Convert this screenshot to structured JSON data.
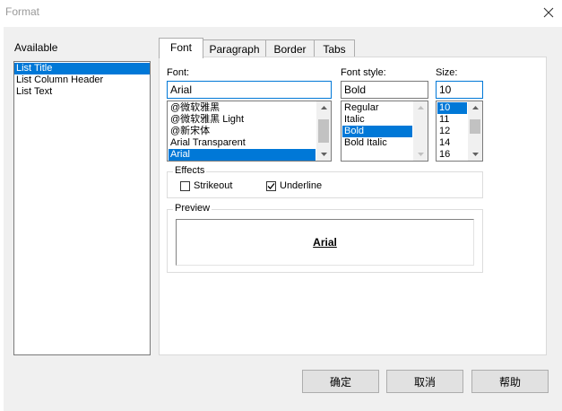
{
  "window": {
    "title": "Format"
  },
  "available": {
    "label": "Available",
    "items": [
      "List Title",
      "List Column Header",
      "List Text"
    ],
    "selected_index": 0
  },
  "tabs": [
    {
      "label": "Font",
      "active": true
    },
    {
      "label": "Paragraph",
      "active": false
    },
    {
      "label": "Border",
      "active": false
    },
    {
      "label": "Tabs",
      "active": false
    }
  ],
  "font": {
    "label": "Font:",
    "value": "Arial",
    "options": [
      "@微软雅黑",
      "@微软雅黑 Light",
      "@新宋体",
      "Arial Transparent",
      "Arial"
    ],
    "selected_index": 4
  },
  "font_style": {
    "label": "Font style:",
    "value": "Bold",
    "options": [
      "Regular",
      "Italic",
      "Bold",
      "Bold Italic"
    ],
    "selected_index": 2
  },
  "size": {
    "label": "Size:",
    "value": "10",
    "options": [
      "10",
      "11",
      "12",
      "14",
      "16"
    ],
    "selected_index": 0
  },
  "effects": {
    "label": "Effects",
    "strikeout": {
      "label": "Strikeout",
      "checked": false
    },
    "underline": {
      "label": "Underline",
      "checked": true
    }
  },
  "preview": {
    "label": "Preview",
    "text": "Arial"
  },
  "buttons": {
    "ok": "确定",
    "cancel": "取消",
    "help": "帮助"
  },
  "colors": {
    "selection": "#0078d7",
    "focus_border": "#0078d7",
    "dialog_bg": "#f0f0f0"
  },
  "icons": {
    "close": "close-icon",
    "scroll_up": "chevron-up-icon",
    "scroll_down": "chevron-down-icon",
    "check": "checkmark-icon"
  }
}
